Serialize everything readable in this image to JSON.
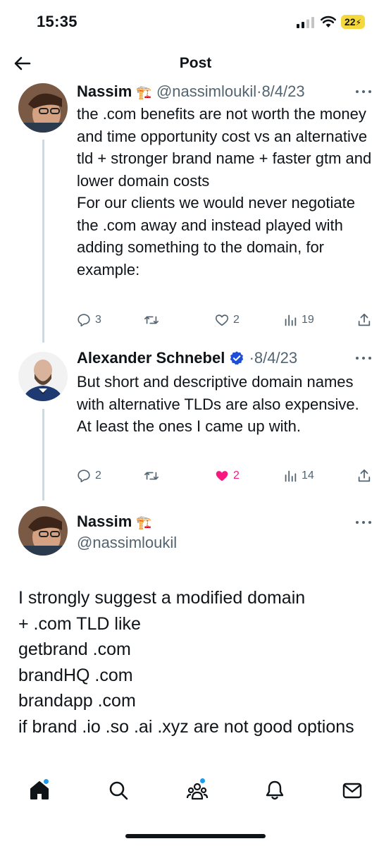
{
  "status_bar": {
    "time": "15:35",
    "battery": "22"
  },
  "header": {
    "title": "Post",
    "back_icon": "arrow-left-icon"
  },
  "tweets": [
    {
      "name": "Nassim",
      "emoji": "🏗️",
      "handle": "@nassimloukil",
      "date": "8/4/23",
      "text": "the .com benefits are not worth the money and time opportunity cost vs an alternative tld + stronger brand name + faster gtm and lower domain costs\nFor our clients we would never negotiate the .com away and instead played with adding something to the domain, for example:",
      "replies": "3",
      "retweets": "",
      "likes": "2",
      "views": "19"
    },
    {
      "name": "Alexander Schnebel",
      "verified": true,
      "date": "8/4/23",
      "text": "But short and descriptive domain names with alternative TLDs are also expensive. At least the ones I came up with.",
      "replies": "2",
      "retweets": "",
      "likes": "2",
      "liked": true,
      "views": "14"
    }
  ],
  "main_tweet": {
    "name": "Nassim",
    "emoji": "🏗️",
    "handle": "@nassimloukil",
    "text": "I strongly suggest a modified domain\n+ .com TLD like\ngetbrand .com\nbrandHQ .com\nbrandapp .com\nif brand .io .so .ai .xyz are not good options"
  },
  "bottom_nav": {
    "items": [
      "home-icon",
      "search-icon",
      "communities-icon",
      "notifications-icon",
      "messages-icon"
    ]
  },
  "colors": {
    "accent": "#1d9bf0",
    "like": "#f91880",
    "secondary_text": "#536471",
    "verified": "#1d4ed8"
  }
}
